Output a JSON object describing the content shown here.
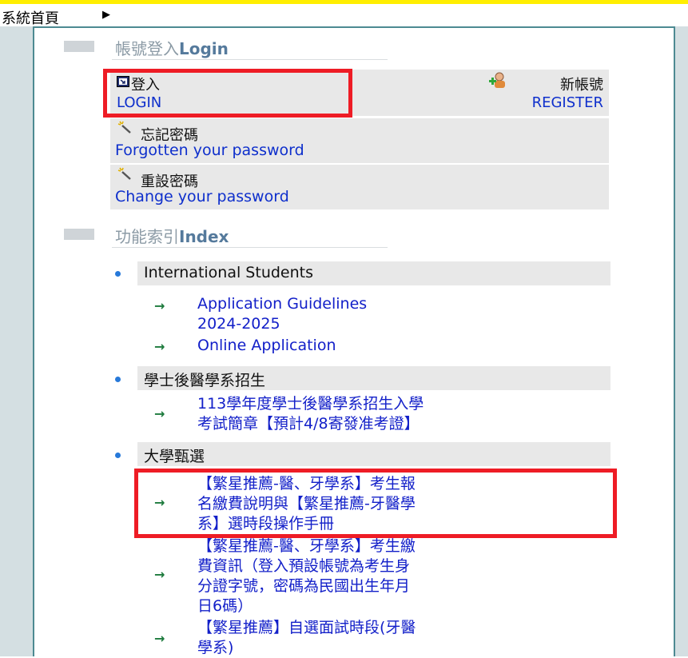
{
  "breadcrumb": {
    "label": "系統首頁",
    "arrow_icon": "play-arrow-icon"
  },
  "login_section": {
    "title_zh": "帳號登入",
    "title_en": "Login",
    "login_zh": "登入",
    "login_en": "LOGIN",
    "register_zh": "新帳號",
    "register_en": "REGISTER",
    "forgot_zh": "忘記密碼",
    "forgot_en": "Forgotten your password",
    "reset_zh": "重設密碼",
    "reset_en": "Change your password"
  },
  "index_section": {
    "title_zh": "功能索引",
    "title_en": "Index",
    "categories": [
      {
        "label": "International Students",
        "links": [
          {
            "line1": "Application Guidelines",
            "line2": "2024-2025"
          },
          {
            "line1": "Online Application"
          }
        ]
      },
      {
        "label": "學士後醫學系招生",
        "links": [
          {
            "line1": "113學年度學士後醫學系招生入學",
            "line2": "考試簡章【預計4/8寄發准考證】"
          }
        ]
      },
      {
        "label": "大學甄選",
        "links": [
          {
            "line1": "【繁星推薦-醫、牙學系】考生報",
            "line2": "名繳費說明與【繁星推薦-牙醫學",
            "line3": "系】選時段操作手冊"
          },
          {
            "line1": "【繁星推薦-醫、牙學系】考生繳",
            "line2": "費資訊（登入預設帳號為考生身",
            "line3": "分證字號，密碼為民國出生年月",
            "line4": "日6碼）"
          },
          {
            "line1": "【繁星推薦】自選面試時段(牙醫",
            "line2": "學系)"
          }
        ]
      }
    ]
  },
  "colors": {
    "highlight": "#ee1c25",
    "link": "#1320c9",
    "en_link": "#0e2fcc",
    "panel_border": "#4d8a92",
    "top_bar": "#ffee00"
  }
}
